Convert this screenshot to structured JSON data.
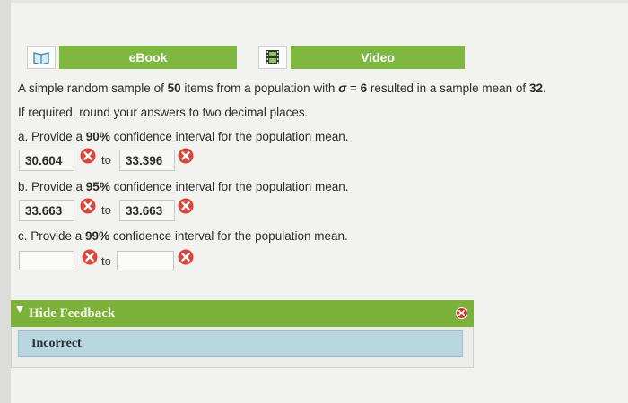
{
  "tabs": {
    "ebook_label": "eBook",
    "video_label": "Video",
    "ebook_icon": "book-icon",
    "video_icon": "film-icon",
    "tab_color": "#7fb83f"
  },
  "question": {
    "stem_parts": [
      "A simple random sample of ",
      "50",
      " items from a population with ",
      "σ",
      " = ",
      "6",
      " resulted in a sample mean of ",
      "32",
      "."
    ],
    "instruction": "If required, round your answers to two decimal places.",
    "parts": [
      {
        "prompt_parts": [
          "a. Provide a ",
          "90%",
          " confidence interval for the population mean."
        ],
        "lower": "30.604",
        "upper": "33.396",
        "connector": "to"
      },
      {
        "prompt_parts": [
          "b. Provide a ",
          "95%",
          " confidence interval for the population mean."
        ],
        "lower": "33.663",
        "upper": "33.663",
        "connector": "to"
      },
      {
        "prompt_parts": [
          "c. Provide a ",
          "99%",
          " confidence interval for the population mean."
        ],
        "lower": "",
        "upper": "",
        "connector": "to"
      }
    ]
  },
  "status_icon": "incorrect-x-icon",
  "feedback": {
    "toggle_label": "Hide Feedback",
    "result": "Incorrect",
    "header_color": "#7cb23a",
    "result_color": "#b7d6e0"
  }
}
